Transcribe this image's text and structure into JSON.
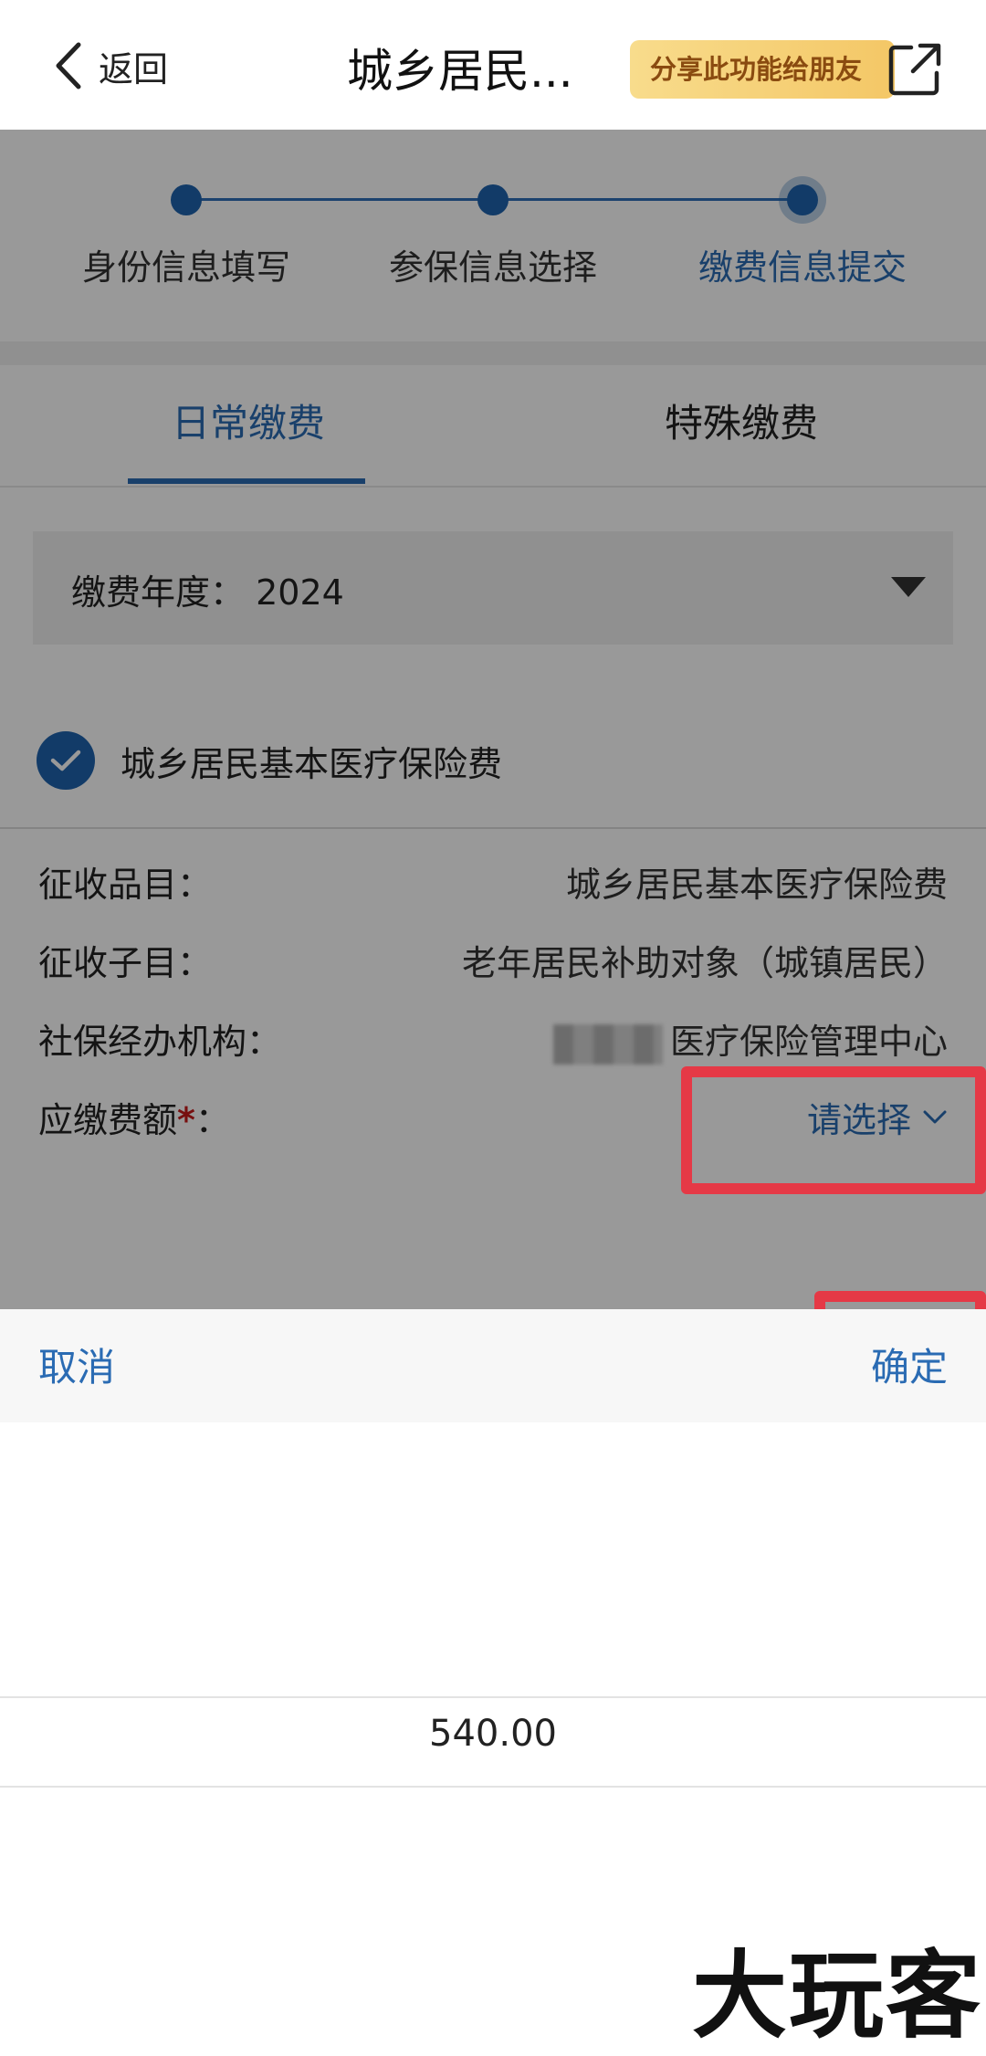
{
  "nav": {
    "back_label": "返回",
    "title": "城乡居民...",
    "share_label": "分享此功能给朋友"
  },
  "steps": [
    {
      "label": "身份信息填写",
      "state": "done"
    },
    {
      "label": "参保信息选择",
      "state": "done"
    },
    {
      "label": "缴费信息提交",
      "state": "active"
    }
  ],
  "tabs": [
    {
      "label": "日常缴费",
      "active": true
    },
    {
      "label": "特殊缴费",
      "active": false
    }
  ],
  "year_select": {
    "label": "缴费年度：",
    "value": "2024"
  },
  "insurance_item": {
    "label": "城乡居民基本医疗保险费",
    "checked": true
  },
  "info": {
    "category_key": "征收品目：",
    "category_value": "城乡居民基本医疗保险费",
    "sub_key": "征收子目：",
    "sub_value": "老年居民补助对象（城镇居民）",
    "agency_key": "社保经办机构：",
    "agency_value": "医疗保险管理中心",
    "amount_key": "应缴费额",
    "amount_required": "*",
    "amount_colon": "：",
    "amount_value": "请选择"
  },
  "picker": {
    "cancel_label": "取消",
    "confirm_label": "确定",
    "options": [
      "540.00"
    ]
  },
  "watermark": "大玩客",
  "colors": {
    "accent": "#2a6bb3",
    "highlight": "#e53946",
    "required": "#c71a1a"
  }
}
